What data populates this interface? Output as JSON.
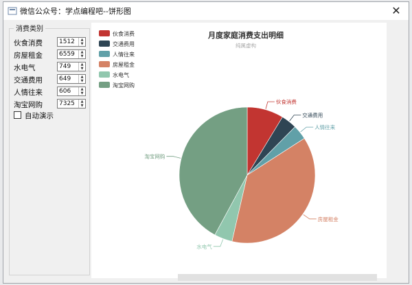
{
  "window": {
    "title": "微信公众号：学点编程吧--饼形图",
    "close_symbol": "✕"
  },
  "group": {
    "title": "消费类别",
    "items": [
      {
        "label": "伙食消费",
        "value": "1512"
      },
      {
        "label": "房屋租金",
        "value": "6559"
      },
      {
        "label": "水电气",
        "value": "749"
      },
      {
        "label": "交通费用",
        "value": "649"
      },
      {
        "label": "人情往来",
        "value": "606"
      },
      {
        "label": "淘宝网购",
        "value": "7325"
      }
    ],
    "auto_demo_label": "自动演示"
  },
  "chart_data": {
    "type": "pie",
    "title": "月度家庭消费支出明细",
    "subtitle": "纯属虚构",
    "legend_position": "top-left",
    "slices": [
      {
        "name": "伙食消费",
        "value": 1512,
        "color": "#c23531"
      },
      {
        "name": "交通费用",
        "value": 649,
        "color": "#2f4554"
      },
      {
        "name": "人情往来",
        "value": 606,
        "color": "#61a0a8"
      },
      {
        "name": "房屋租金",
        "value": 6559,
        "color": "#d48265"
      },
      {
        "name": "水电气",
        "value": 749,
        "color": "#91c7ae"
      },
      {
        "name": "淘宝网购",
        "value": 7325,
        "color": "#749f83"
      }
    ],
    "legend_order": [
      "伙食消费",
      "交通费用",
      "人情往来",
      "房屋租金",
      "水电气",
      "淘宝网购"
    ]
  }
}
